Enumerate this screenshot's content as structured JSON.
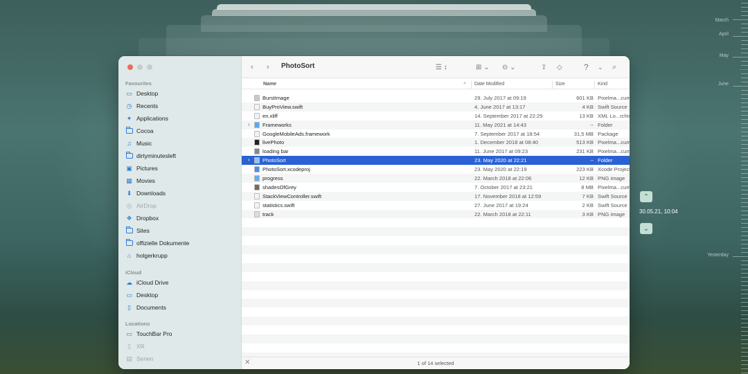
{
  "window": {
    "title": "PhotoSort",
    "status": "1 of 14 selected"
  },
  "sidebar": {
    "favourites_label": "Favourites",
    "favourites": [
      {
        "label": "Desktop",
        "icon": "desktop-icon"
      },
      {
        "label": "Recents",
        "icon": "clock-icon"
      },
      {
        "label": "Applications",
        "icon": "applications-icon"
      },
      {
        "label": "Cocoa",
        "icon": "folder-icon"
      },
      {
        "label": "Music",
        "icon": "music-icon"
      },
      {
        "label": "dirtyminutesleft",
        "icon": "folder-icon"
      },
      {
        "label": "Pictures",
        "icon": "pictures-icon"
      },
      {
        "label": "Movies",
        "icon": "movies-icon"
      },
      {
        "label": "Downloads",
        "icon": "downloads-icon"
      },
      {
        "label": "AirDrop",
        "icon": "airdrop-icon"
      },
      {
        "label": "Dropbox",
        "icon": "dropbox-icon"
      },
      {
        "label": "Sites",
        "icon": "folder-icon"
      },
      {
        "label": "offizielle Dokumente",
        "icon": "folder-icon"
      },
      {
        "label": "holgerkrupp",
        "icon": "home-icon"
      }
    ],
    "icloud_label": "iCloud",
    "icloud": [
      {
        "label": "iCloud Drive",
        "icon": "cloud-icon"
      },
      {
        "label": "Desktop",
        "icon": "desktop-icon"
      },
      {
        "label": "Documents",
        "icon": "document-icon"
      }
    ],
    "locations_label": "Locations",
    "locations": [
      {
        "label": "TouchBar Pro",
        "icon": "laptop-icon"
      },
      {
        "label": "XR",
        "icon": "phone-icon"
      },
      {
        "label": "Serien",
        "icon": "drive-icon"
      }
    ]
  },
  "columns": {
    "name": "Name",
    "date": "Date Modified",
    "size": "Size",
    "kind": "Kind"
  },
  "files": [
    {
      "name": "BurstImage",
      "date": "29. July 2017 at 09:19",
      "size": "601 KB",
      "kind": "Pixelma...cument",
      "icon_color": "#c9c9c9",
      "folder": false
    },
    {
      "name": "BuyProView.swift",
      "date": "4. June 2017 at 13:17",
      "size": "4 KB",
      "kind": "Swift Source",
      "icon_color": "#f4f4f4",
      "folder": false
    },
    {
      "name": "en.xliff",
      "date": "14. September 2017 at 22:29",
      "size": "13 KB",
      "kind": "XML Lo...rchive",
      "icon_color": "#eef3fb",
      "folder": false
    },
    {
      "name": "Frameworks",
      "date": "11. May 2021 at 14:43",
      "size": "--",
      "kind": "Folder",
      "icon_color": "#5aa9f0",
      "folder": true
    },
    {
      "name": "GoogleMobileAds.framework",
      "date": "7. September 2017 at 18:54",
      "size": "31,5 MB",
      "kind": "Package",
      "icon_color": "#f2f2f2",
      "folder": false
    },
    {
      "name": "livePhoto",
      "date": "1. December 2018 at 08:40",
      "size": "513 KB",
      "kind": "Pixelma...cument",
      "icon_color": "#222222",
      "folder": false
    },
    {
      "name": "loading bar",
      "date": "11. June 2017 at 09:23",
      "size": "231 KB",
      "kind": "Pixelma...cument",
      "icon_color": "#888888",
      "folder": false
    },
    {
      "name": "PhotoSort",
      "date": "23. May 2020 at 22:21",
      "size": "--",
      "kind": "Folder",
      "icon_color": "#8fc4f5",
      "folder": true,
      "selected": true
    },
    {
      "name": "PhotoSort.xcodeproj",
      "date": "23. May 2020 at 22:19",
      "size": "223 KB",
      "kind": "Xcode Project",
      "icon_color": "#4a8fe0",
      "folder": false
    },
    {
      "name": "progress",
      "date": "22. March 2018 at 22:06",
      "size": "12 KB",
      "kind": "PNG image",
      "icon_color": "#6aaee8",
      "folder": false
    },
    {
      "name": "shadesOfGrey",
      "date": "7. October 2017 at 23:21",
      "size": "8 MB",
      "kind": "Pixelma...cument",
      "icon_color": "#7a6a5a",
      "folder": false
    },
    {
      "name": "StackViewController.swift",
      "date": "17. November 2018 at 12:59",
      "size": "7 KB",
      "kind": "Swift Source",
      "icon_color": "#f4f4f4",
      "folder": false
    },
    {
      "name": "statistics.swift",
      "date": "27. June 2017 at 19:24",
      "size": "2 KB",
      "kind": "Swift Source",
      "icon_color": "#f4f4f4",
      "folder": false
    },
    {
      "name": "track",
      "date": "22. March 2018 at 22:11",
      "size": "3 KB",
      "kind": "PNG image",
      "icon_color": "#dddddd",
      "folder": false
    }
  ],
  "time_machine": {
    "date": "30.05.21, 10:04",
    "timeline": [
      "March",
      "April",
      "May",
      "June",
      "Yesterday"
    ]
  }
}
